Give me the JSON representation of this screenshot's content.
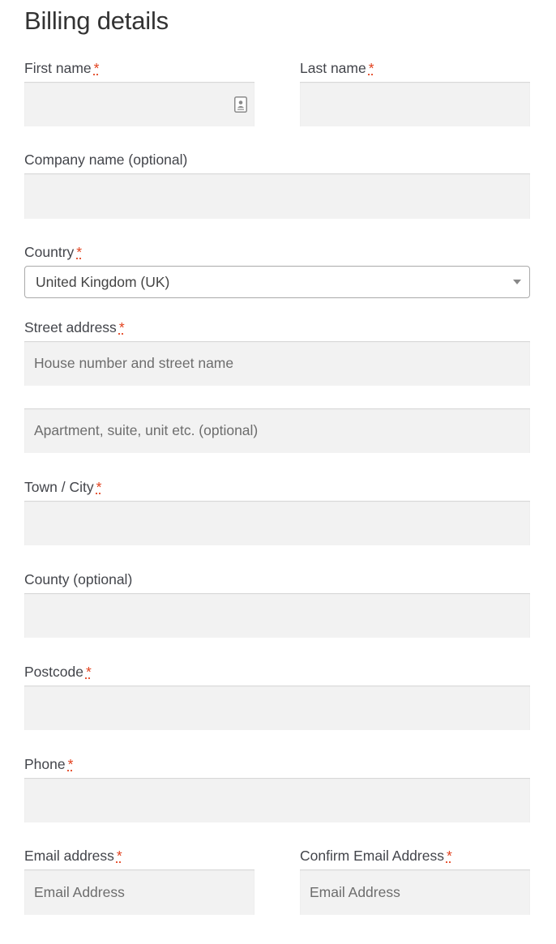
{
  "title": "Billing details",
  "required_mark": "*",
  "fields": {
    "first_name": {
      "label": "First name",
      "value": ""
    },
    "last_name": {
      "label": "Last name",
      "value": ""
    },
    "company": {
      "label": "Company name (optional)",
      "value": ""
    },
    "country": {
      "label": "Country",
      "selected": "United Kingdom (UK)"
    },
    "street": {
      "label": "Street address",
      "line1_placeholder": "House number and street name",
      "line2_placeholder": "Apartment, suite, unit etc. (optional)"
    },
    "city": {
      "label": "Town / City",
      "value": ""
    },
    "county": {
      "label": "County (optional)",
      "value": ""
    },
    "postcode": {
      "label": "Postcode",
      "value": ""
    },
    "phone": {
      "label": "Phone",
      "value": ""
    },
    "email": {
      "label": "Email address",
      "placeholder": "Email Address"
    },
    "confirm_email": {
      "label": "Confirm Email Address",
      "placeholder": "Email Address"
    }
  },
  "icons": {
    "autofill": "contact-card-icon",
    "dropdown": "chevron-down-icon"
  },
  "colors": {
    "required": "#e2401c",
    "input_bg": "#f2f2f2",
    "text": "#43454b"
  }
}
